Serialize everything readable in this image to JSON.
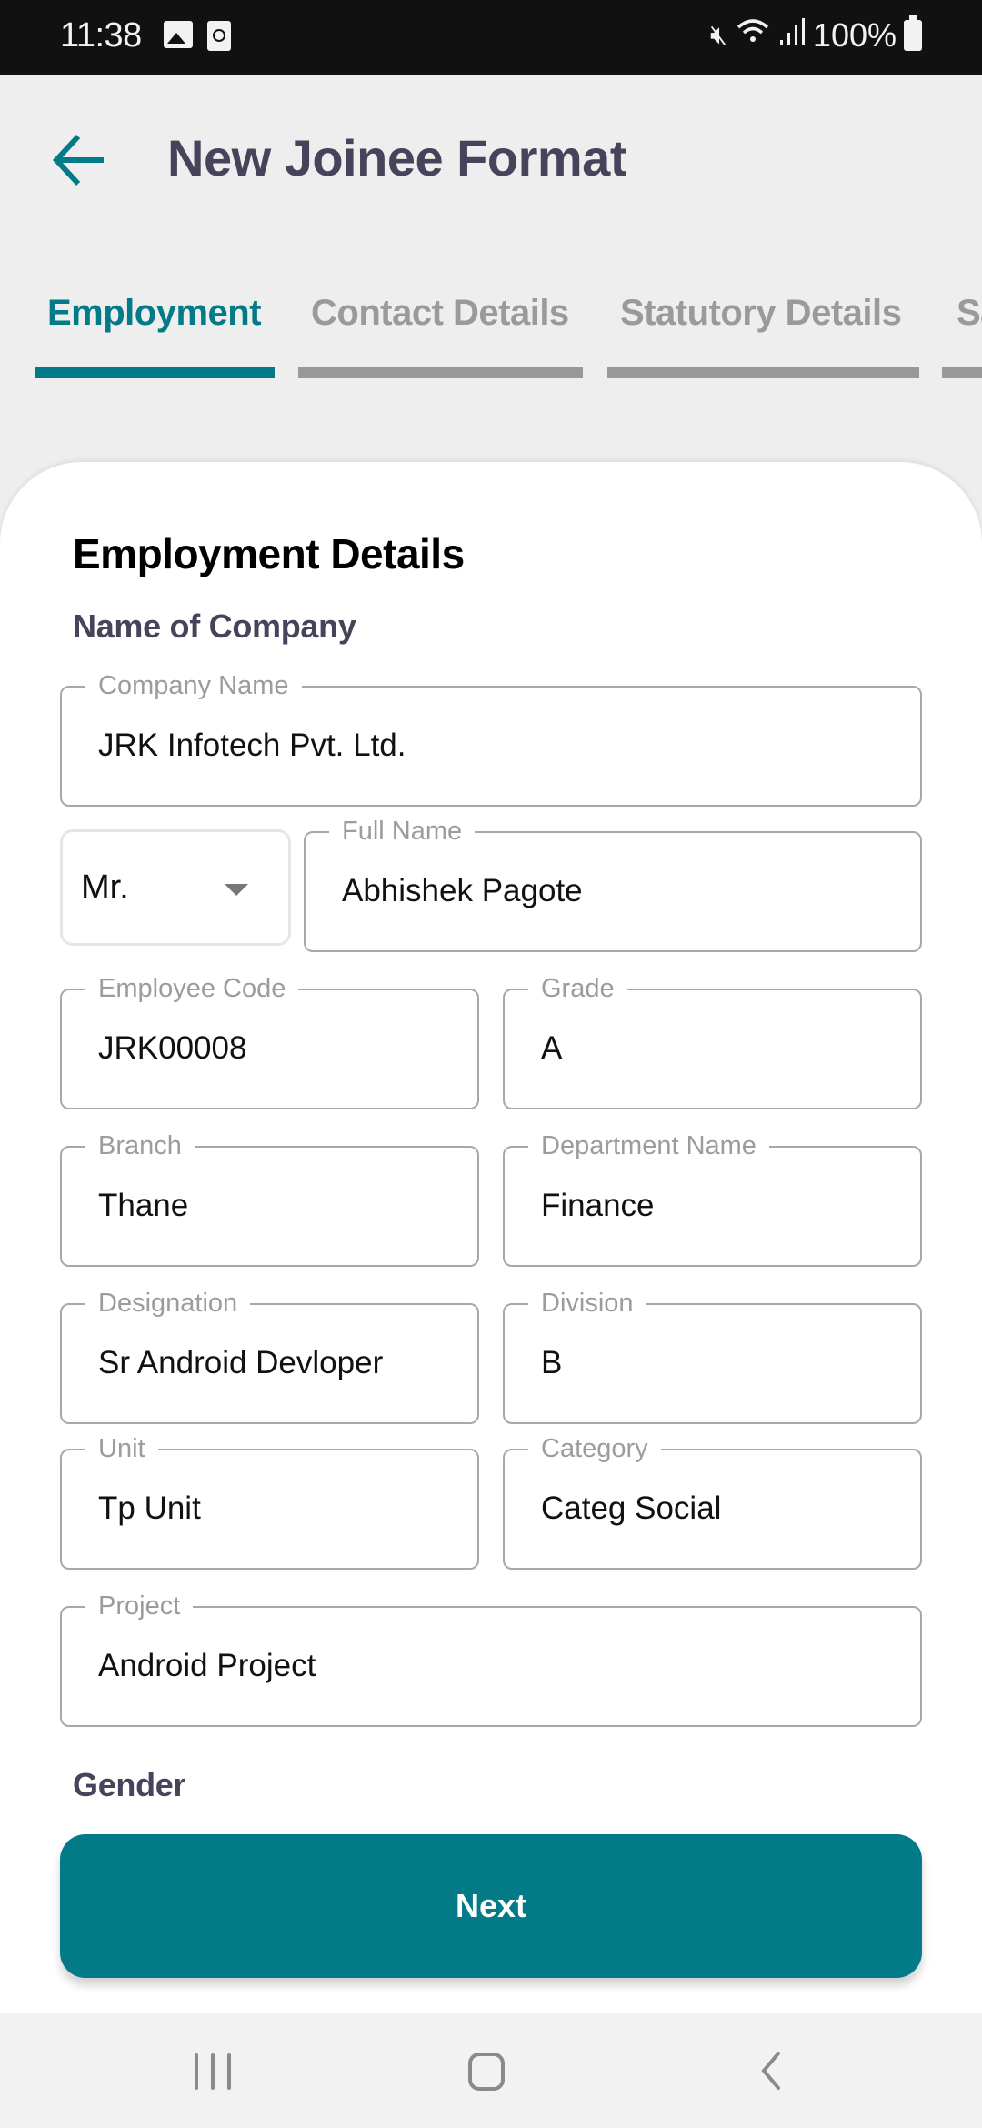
{
  "status_bar": {
    "time": "11:38",
    "notification_icons": [
      "image-icon",
      "clock-notification-icon"
    ],
    "system_icons": [
      "mute-icon",
      "wifi-icon",
      "signal-icon"
    ],
    "battery": "100%"
  },
  "header": {
    "title": "New Joinee Format",
    "back_icon": "arrow-left-icon"
  },
  "tabs": [
    {
      "label": "Employment",
      "active": true
    },
    {
      "label": "Contact Details",
      "active": false
    },
    {
      "label": "Statutory Details",
      "active": false
    },
    {
      "label": "Sa",
      "active": false
    }
  ],
  "form": {
    "section_title": "Employment Details",
    "company_heading": "Name of Company",
    "company_name": {
      "label": "Company Name",
      "value": "JRK Infotech Pvt. Ltd."
    },
    "salutation": {
      "value": "Mr."
    },
    "full_name": {
      "label": "Full Name",
      "value": "Abhishek Pagote"
    },
    "employee_code": {
      "label": "Employee Code",
      "value": "JRK00008"
    },
    "grade": {
      "label": "Grade",
      "value": "A"
    },
    "branch": {
      "label": "Branch",
      "value": "Thane"
    },
    "department": {
      "label": "Department Name",
      "value": "Finance"
    },
    "designation": {
      "label": "Designation",
      "value": "Sr Android Devloper"
    },
    "division": {
      "label": "Division",
      "value": "B"
    },
    "unit": {
      "label": "Unit",
      "value": "Tp Unit"
    },
    "category": {
      "label": "Category",
      "value": "Categ Social"
    },
    "project": {
      "label": "Project",
      "value": "Android Project"
    },
    "gender_heading": "Gender"
  },
  "actions": {
    "next_label": "Next"
  },
  "colors": {
    "accent": "#037a87",
    "title_text": "#45445a",
    "inactive_tab": "#9a9a9a"
  }
}
